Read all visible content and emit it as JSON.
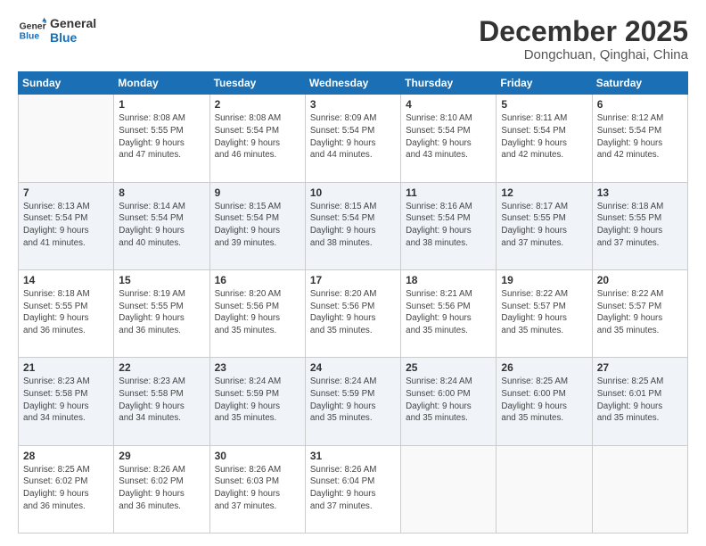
{
  "logo": {
    "line1": "General",
    "line2": "Blue"
  },
  "title": "December 2025",
  "location": "Dongchuan, Qinghai, China",
  "days_header": [
    "Sunday",
    "Monday",
    "Tuesday",
    "Wednesday",
    "Thursday",
    "Friday",
    "Saturday"
  ],
  "weeks": [
    [
      {
        "day": "",
        "info": ""
      },
      {
        "day": "1",
        "info": "Sunrise: 8:08 AM\nSunset: 5:55 PM\nDaylight: 9 hours\nand 47 minutes."
      },
      {
        "day": "2",
        "info": "Sunrise: 8:08 AM\nSunset: 5:54 PM\nDaylight: 9 hours\nand 46 minutes."
      },
      {
        "day": "3",
        "info": "Sunrise: 8:09 AM\nSunset: 5:54 PM\nDaylight: 9 hours\nand 44 minutes."
      },
      {
        "day": "4",
        "info": "Sunrise: 8:10 AM\nSunset: 5:54 PM\nDaylight: 9 hours\nand 43 minutes."
      },
      {
        "day": "5",
        "info": "Sunrise: 8:11 AM\nSunset: 5:54 PM\nDaylight: 9 hours\nand 42 minutes."
      },
      {
        "day": "6",
        "info": "Sunrise: 8:12 AM\nSunset: 5:54 PM\nDaylight: 9 hours\nand 42 minutes."
      }
    ],
    [
      {
        "day": "7",
        "info": "Sunrise: 8:13 AM\nSunset: 5:54 PM\nDaylight: 9 hours\nand 41 minutes."
      },
      {
        "day": "8",
        "info": "Sunrise: 8:14 AM\nSunset: 5:54 PM\nDaylight: 9 hours\nand 40 minutes."
      },
      {
        "day": "9",
        "info": "Sunrise: 8:15 AM\nSunset: 5:54 PM\nDaylight: 9 hours\nand 39 minutes."
      },
      {
        "day": "10",
        "info": "Sunrise: 8:15 AM\nSunset: 5:54 PM\nDaylight: 9 hours\nand 38 minutes."
      },
      {
        "day": "11",
        "info": "Sunrise: 8:16 AM\nSunset: 5:54 PM\nDaylight: 9 hours\nand 38 minutes."
      },
      {
        "day": "12",
        "info": "Sunrise: 8:17 AM\nSunset: 5:55 PM\nDaylight: 9 hours\nand 37 minutes."
      },
      {
        "day": "13",
        "info": "Sunrise: 8:18 AM\nSunset: 5:55 PM\nDaylight: 9 hours\nand 37 minutes."
      }
    ],
    [
      {
        "day": "14",
        "info": "Sunrise: 8:18 AM\nSunset: 5:55 PM\nDaylight: 9 hours\nand 36 minutes."
      },
      {
        "day": "15",
        "info": "Sunrise: 8:19 AM\nSunset: 5:55 PM\nDaylight: 9 hours\nand 36 minutes."
      },
      {
        "day": "16",
        "info": "Sunrise: 8:20 AM\nSunset: 5:56 PM\nDaylight: 9 hours\nand 35 minutes."
      },
      {
        "day": "17",
        "info": "Sunrise: 8:20 AM\nSunset: 5:56 PM\nDaylight: 9 hours\nand 35 minutes."
      },
      {
        "day": "18",
        "info": "Sunrise: 8:21 AM\nSunset: 5:56 PM\nDaylight: 9 hours\nand 35 minutes."
      },
      {
        "day": "19",
        "info": "Sunrise: 8:22 AM\nSunset: 5:57 PM\nDaylight: 9 hours\nand 35 minutes."
      },
      {
        "day": "20",
        "info": "Sunrise: 8:22 AM\nSunset: 5:57 PM\nDaylight: 9 hours\nand 35 minutes."
      }
    ],
    [
      {
        "day": "21",
        "info": "Sunrise: 8:23 AM\nSunset: 5:58 PM\nDaylight: 9 hours\nand 34 minutes."
      },
      {
        "day": "22",
        "info": "Sunrise: 8:23 AM\nSunset: 5:58 PM\nDaylight: 9 hours\nand 34 minutes."
      },
      {
        "day": "23",
        "info": "Sunrise: 8:24 AM\nSunset: 5:59 PM\nDaylight: 9 hours\nand 35 minutes."
      },
      {
        "day": "24",
        "info": "Sunrise: 8:24 AM\nSunset: 5:59 PM\nDaylight: 9 hours\nand 35 minutes."
      },
      {
        "day": "25",
        "info": "Sunrise: 8:24 AM\nSunset: 6:00 PM\nDaylight: 9 hours\nand 35 minutes."
      },
      {
        "day": "26",
        "info": "Sunrise: 8:25 AM\nSunset: 6:00 PM\nDaylight: 9 hours\nand 35 minutes."
      },
      {
        "day": "27",
        "info": "Sunrise: 8:25 AM\nSunset: 6:01 PM\nDaylight: 9 hours\nand 35 minutes."
      }
    ],
    [
      {
        "day": "28",
        "info": "Sunrise: 8:25 AM\nSunset: 6:02 PM\nDaylight: 9 hours\nand 36 minutes."
      },
      {
        "day": "29",
        "info": "Sunrise: 8:26 AM\nSunset: 6:02 PM\nDaylight: 9 hours\nand 36 minutes."
      },
      {
        "day": "30",
        "info": "Sunrise: 8:26 AM\nSunset: 6:03 PM\nDaylight: 9 hours\nand 37 minutes."
      },
      {
        "day": "31",
        "info": "Sunrise: 8:26 AM\nSunset: 6:04 PM\nDaylight: 9 hours\nand 37 minutes."
      },
      {
        "day": "",
        "info": ""
      },
      {
        "day": "",
        "info": ""
      },
      {
        "day": "",
        "info": ""
      }
    ]
  ]
}
